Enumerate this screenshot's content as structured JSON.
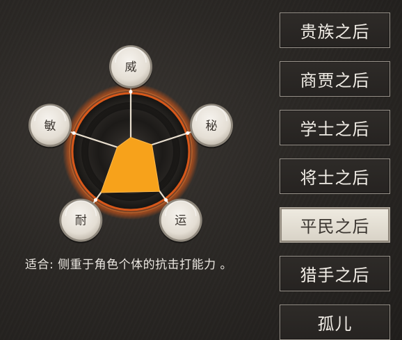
{
  "radar": {
    "stats": [
      {
        "label": "威",
        "value": 0.18
      },
      {
        "label": "秘",
        "value": 0.28
      },
      {
        "label": "运",
        "value": 0.62
      },
      {
        "label": "耐",
        "value": 0.64
      },
      {
        "label": "敏",
        "value": 0.18
      }
    ],
    "fill_color": "#f7a21b",
    "ring_color": "#d8581a"
  },
  "description": "适合: 侧重于角色个体的抗击打能力 。",
  "backgrounds": [
    {
      "label": "贵族之后",
      "selected": false
    },
    {
      "label": "商贾之后",
      "selected": false
    },
    {
      "label": "学士之后",
      "selected": false
    },
    {
      "label": "将士之后",
      "selected": false
    },
    {
      "label": "平民之后",
      "selected": true
    },
    {
      "label": "猎手之后",
      "selected": false
    },
    {
      "label": "孤儿",
      "selected": false
    }
  ]
}
